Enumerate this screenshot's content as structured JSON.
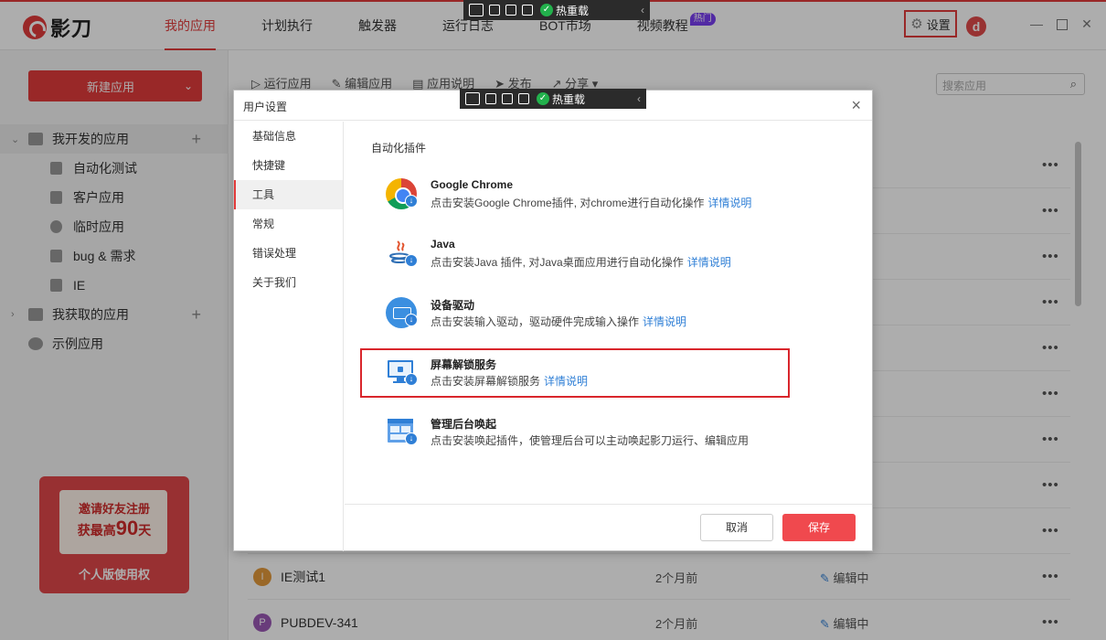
{
  "app": {
    "logo_text": "影刀",
    "brand_color": "#e23b3b"
  },
  "nav": {
    "items": [
      "我的应用",
      "计划执行",
      "触发器",
      "运行日志",
      "BOT市场",
      "视频教程"
    ],
    "hot_badge": "热门",
    "settings_label": "设置",
    "avatar_letter": "d"
  },
  "capture_toolbar": {
    "hot_label": "热重载"
  },
  "sidebar": {
    "new_app_label": "新建应用",
    "my_dev_apps": "我开发的应用",
    "children": [
      "自动化测试",
      "客户应用",
      "临时应用",
      "bug & 需求",
      "IE"
    ],
    "acquired_apps": "我获取的应用",
    "example_apps": "示例应用",
    "promo": {
      "line1": "邀请好友注册",
      "line2_prefix": "获最高",
      "line2_num": "90",
      "line2_suffix": "天",
      "line3": "个人版使用权"
    }
  },
  "main": {
    "toolbar": [
      "运行应用",
      "编辑应用",
      "应用说明",
      "发布",
      "分享"
    ],
    "search_placeholder": "搜索应用",
    "rows": [
      {
        "letter": "I",
        "color": "#e39a3b",
        "name": "IE测试1",
        "when": "2个月前",
        "status": "编辑中"
      },
      {
        "letter": "P",
        "color": "#9b59b6",
        "name": "PUBDEV-341",
        "when": "2个月前",
        "status": "编辑中"
      }
    ]
  },
  "dialog": {
    "title": "用户设置",
    "menu": [
      "基础信息",
      "快捷键",
      "工具",
      "常规",
      "错误处理",
      "关于我们"
    ],
    "active_menu": "工具",
    "section_title": "自动化插件",
    "link_text": "详情说明",
    "plugins": [
      {
        "icon": "chrome-icon",
        "name": "Google Chrome",
        "desc": "点击安装Google Chrome插件, 对chrome进行自动化操作"
      },
      {
        "icon": "java-icon",
        "name": "Java",
        "desc": "点击安装Java 插件, 对Java桌面应用进行自动化操作"
      },
      {
        "icon": "device-driver-icon",
        "name": "设备驱动",
        "desc": "点击安装输入驱动，驱动硬件完成输入操作"
      },
      {
        "icon": "screen-unlock-icon",
        "name": "屏幕解锁服务",
        "desc": "点击安装屏幕解锁服务"
      },
      {
        "icon": "admin-wakeup-icon",
        "name": "管理后台唤起",
        "desc": "点击安装唤起插件，使管理后台可以主动唤起影刀运行、编辑应用"
      }
    ],
    "cancel_label": "取消",
    "save_label": "保存"
  }
}
